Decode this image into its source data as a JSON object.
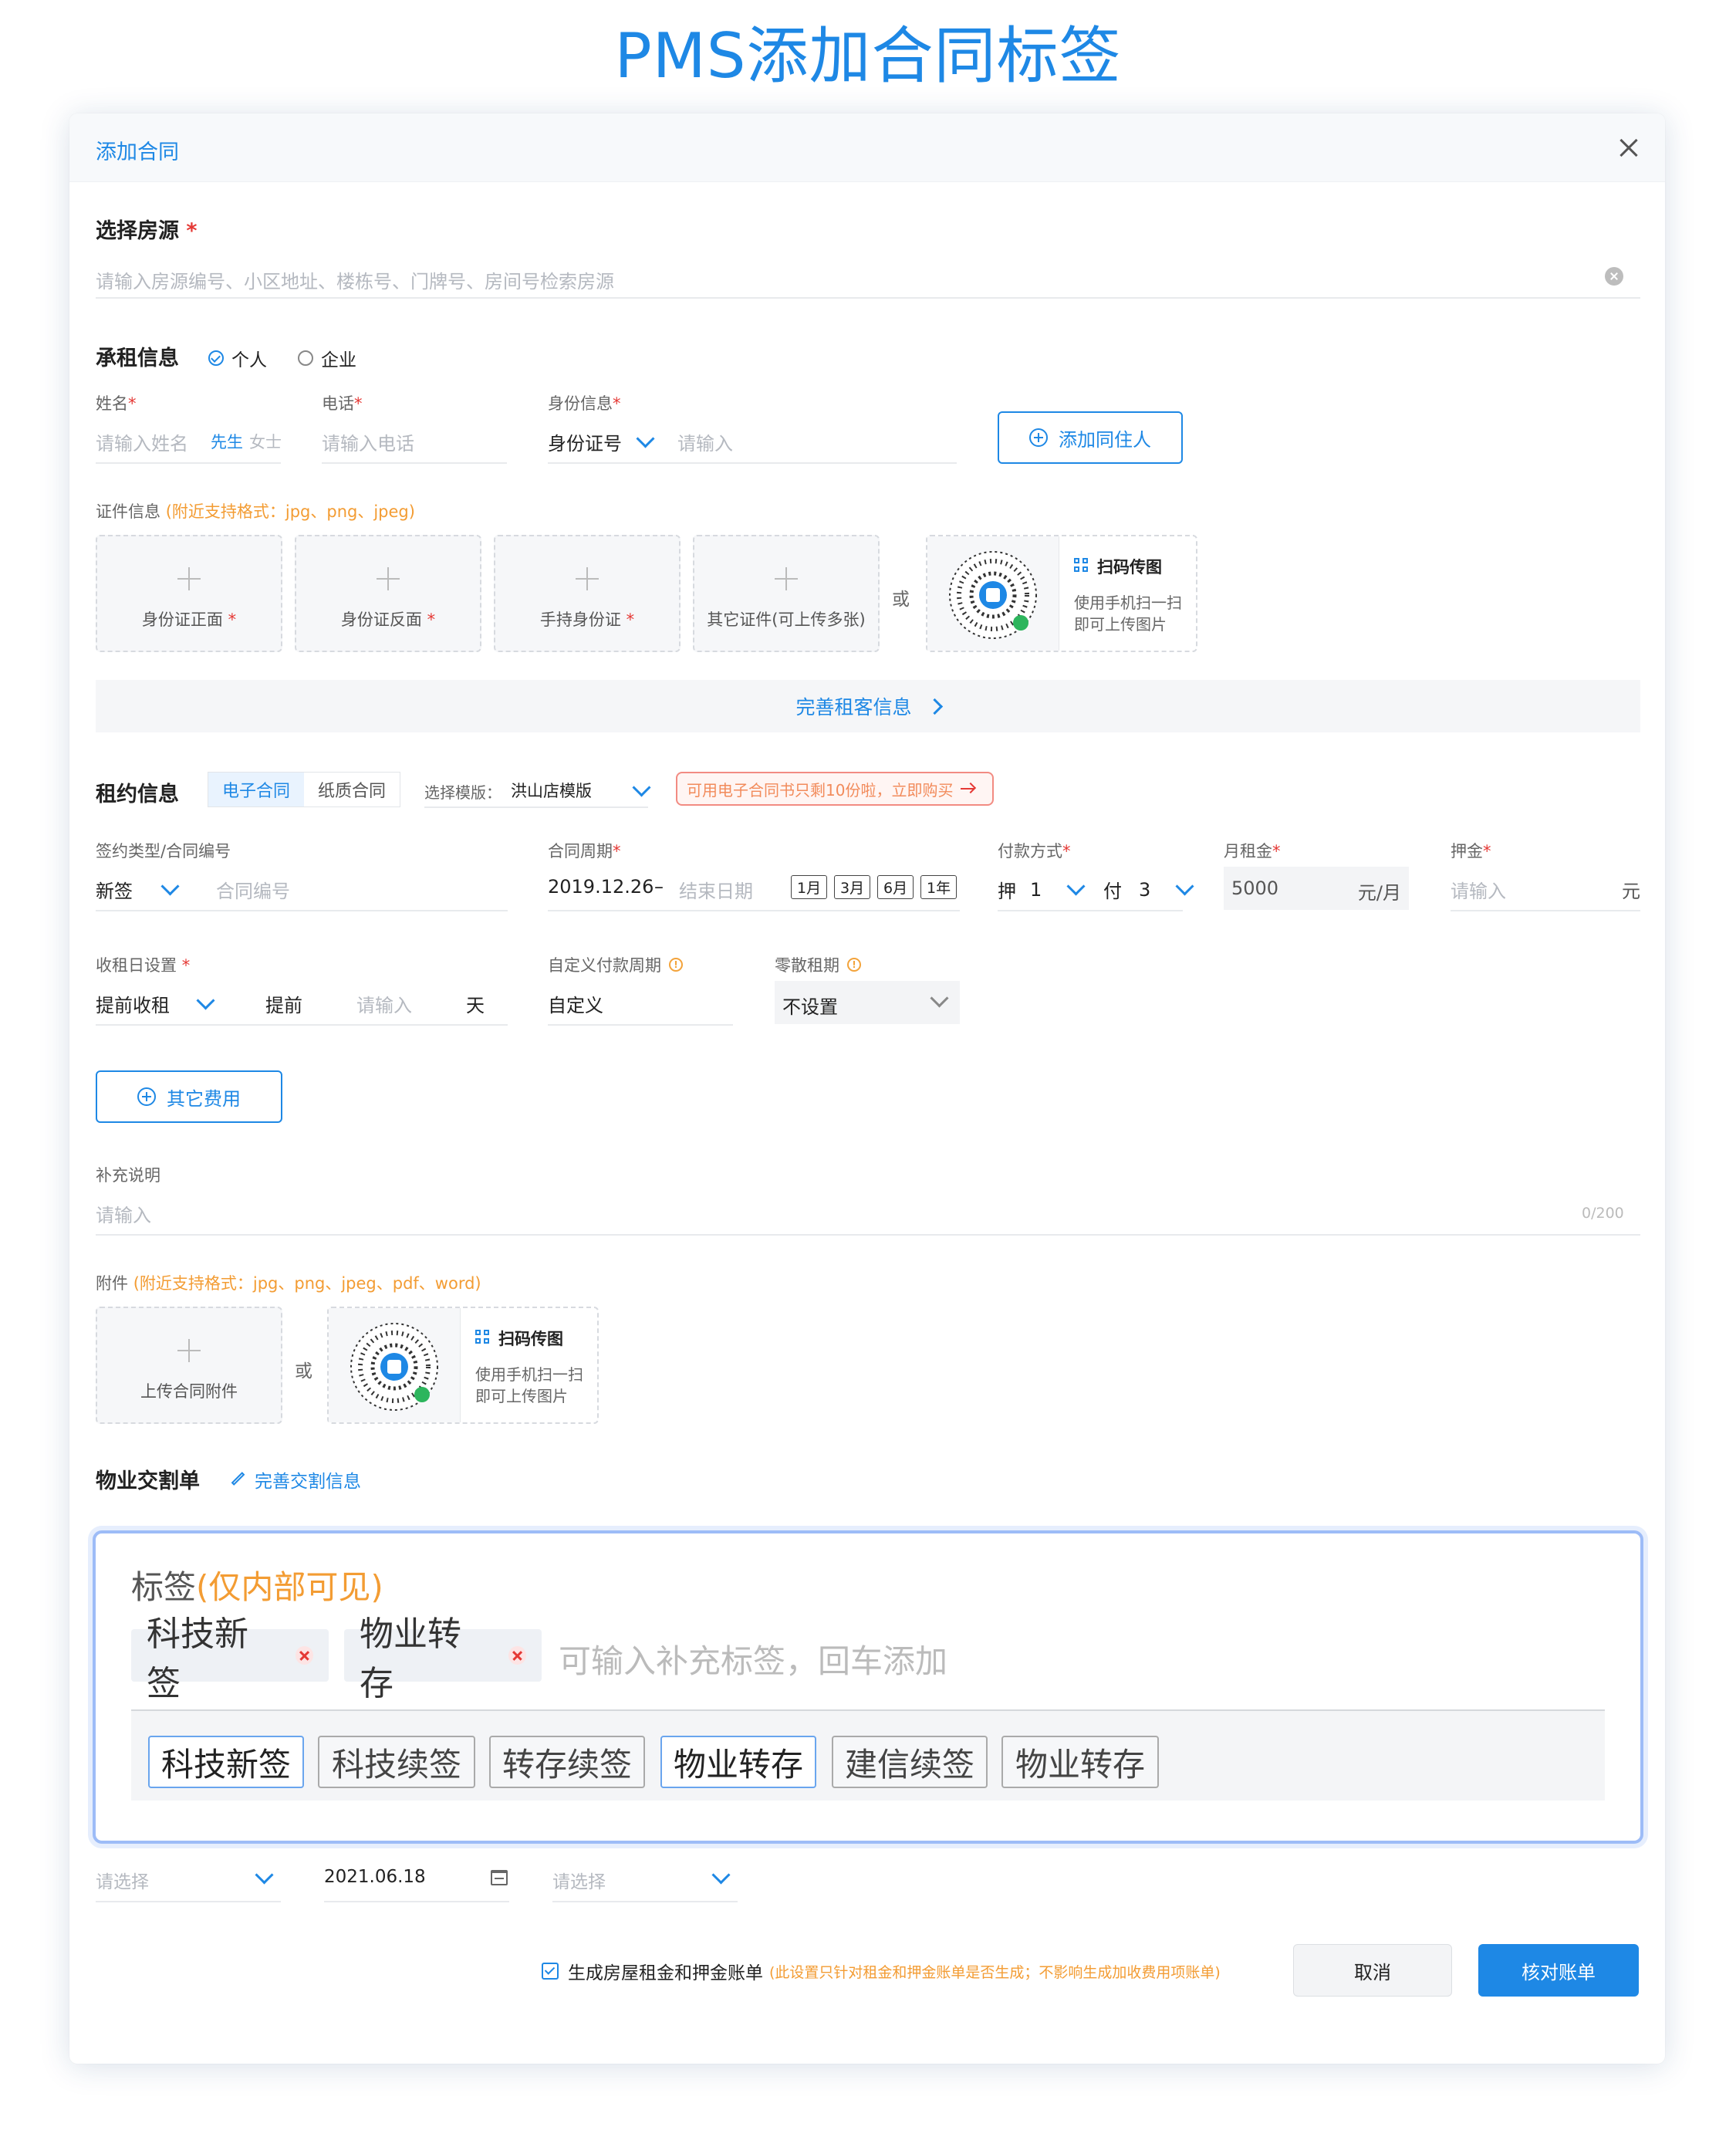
{
  "page_title": "PMS添加合同标签",
  "modal": {
    "title": "添加合同",
    "room": {
      "label": "选择房源",
      "placeholder": "请输入房源编号、小区地址、楼栋号、门牌号、房间号检索房源"
    },
    "tenant": {
      "title": "承租信息",
      "type_options": [
        "个人",
        "企业"
      ],
      "name_label": "姓名",
      "name_placeholder": "请输入姓名",
      "gender_options": [
        "先生",
        "女士"
      ],
      "phone_label": "电话",
      "phone_placeholder": "请输入电话",
      "id_label": "身份信息",
      "id_type": "身份证号",
      "id_placeholder": "请输入",
      "add_cohabitant": "添加同住人",
      "cert_label": "证件信息",
      "cert_hint": "(附近支持格式：jpg、png、jpeg)",
      "uploads": [
        "身份证正面",
        "身份证反面",
        "手持身份证",
        "其它证件(可上传多张)"
      ],
      "or": "或",
      "scan_title": "扫码传图",
      "scan_desc_1": "使用手机扫一扫",
      "scan_desc_2": "即可上传图片",
      "complete_info": "完善租客信息"
    },
    "lease": {
      "title": "租约信息",
      "contract_tabs": [
        "电子合同",
        "纸质合同"
      ],
      "template_label": "选择模版：",
      "template_value": "洪山店模版",
      "warning": "可用电子合同书只剩10份啦，立即购买",
      "sign_label": "签约类型/合同编号",
      "sign_type": "新签",
      "contract_no_placeholder": "合同编号",
      "period_label": "合同周期",
      "start_date": "2019.12.26",
      "dash": "–",
      "end_placeholder": "结束日期",
      "period_chips": [
        "1月",
        "3月",
        "6月",
        "1年"
      ],
      "pay_label": "付款方式",
      "deposit_prefix": "押",
      "deposit_months": "1",
      "pay_prefix": "付",
      "pay_months": "3",
      "rent_label": "月租金",
      "rent_value": "5000",
      "rent_unit": "元/月",
      "deposit_label": "押金",
      "deposit_placeholder": "请输入",
      "deposit_unit": "元",
      "collect_label": "收租日设置",
      "collect_type": "提前收租",
      "collect_prefix": "提前",
      "collect_placeholder": "请输入",
      "collect_unit": "天",
      "custom_cycle_label": "自定义付款周期",
      "custom_cycle_value": "自定义",
      "odd_label": "零散租期",
      "odd_value": "不设置",
      "other_fees": "其它费用",
      "remark_label": "补充说明",
      "remark_placeholder": "请输入",
      "remark_count": "0/200",
      "attach_label": "附件",
      "attach_hint": "(附近支持格式：jpg、png、jpeg、pdf、word)",
      "attach_upload": "上传合同附件",
      "handover_title": "物业交割单",
      "handover_link": "完善交割信息"
    },
    "tags": {
      "title": "标签",
      "title_hint": "(仅内部可见)",
      "selected": [
        "科技新签",
        "物业转存"
      ],
      "input_placeholder": "可输入补充标签，回车添加",
      "options": [
        "科技新签",
        "科技续签",
        "转存续签",
        "物业转存",
        "建信续签",
        "物业转存"
      ]
    },
    "bottom_row": {
      "select_1_placeholder": "请选择",
      "date_value": "2021.06.18",
      "select_2_placeholder": "请选择"
    },
    "footer": {
      "generate_label": "生成房屋租金和押金账单",
      "generate_hint": "(此设置只针对租金和押金账单是否生成；不影响生成加收费用项账单)",
      "cancel": "取消",
      "confirm": "核对账单"
    }
  },
  "colors": {
    "accent": "#1e88e5",
    "required": "#e53935",
    "hint": "#f39c33",
    "tag_panel_border": "#9dbcf7"
  }
}
